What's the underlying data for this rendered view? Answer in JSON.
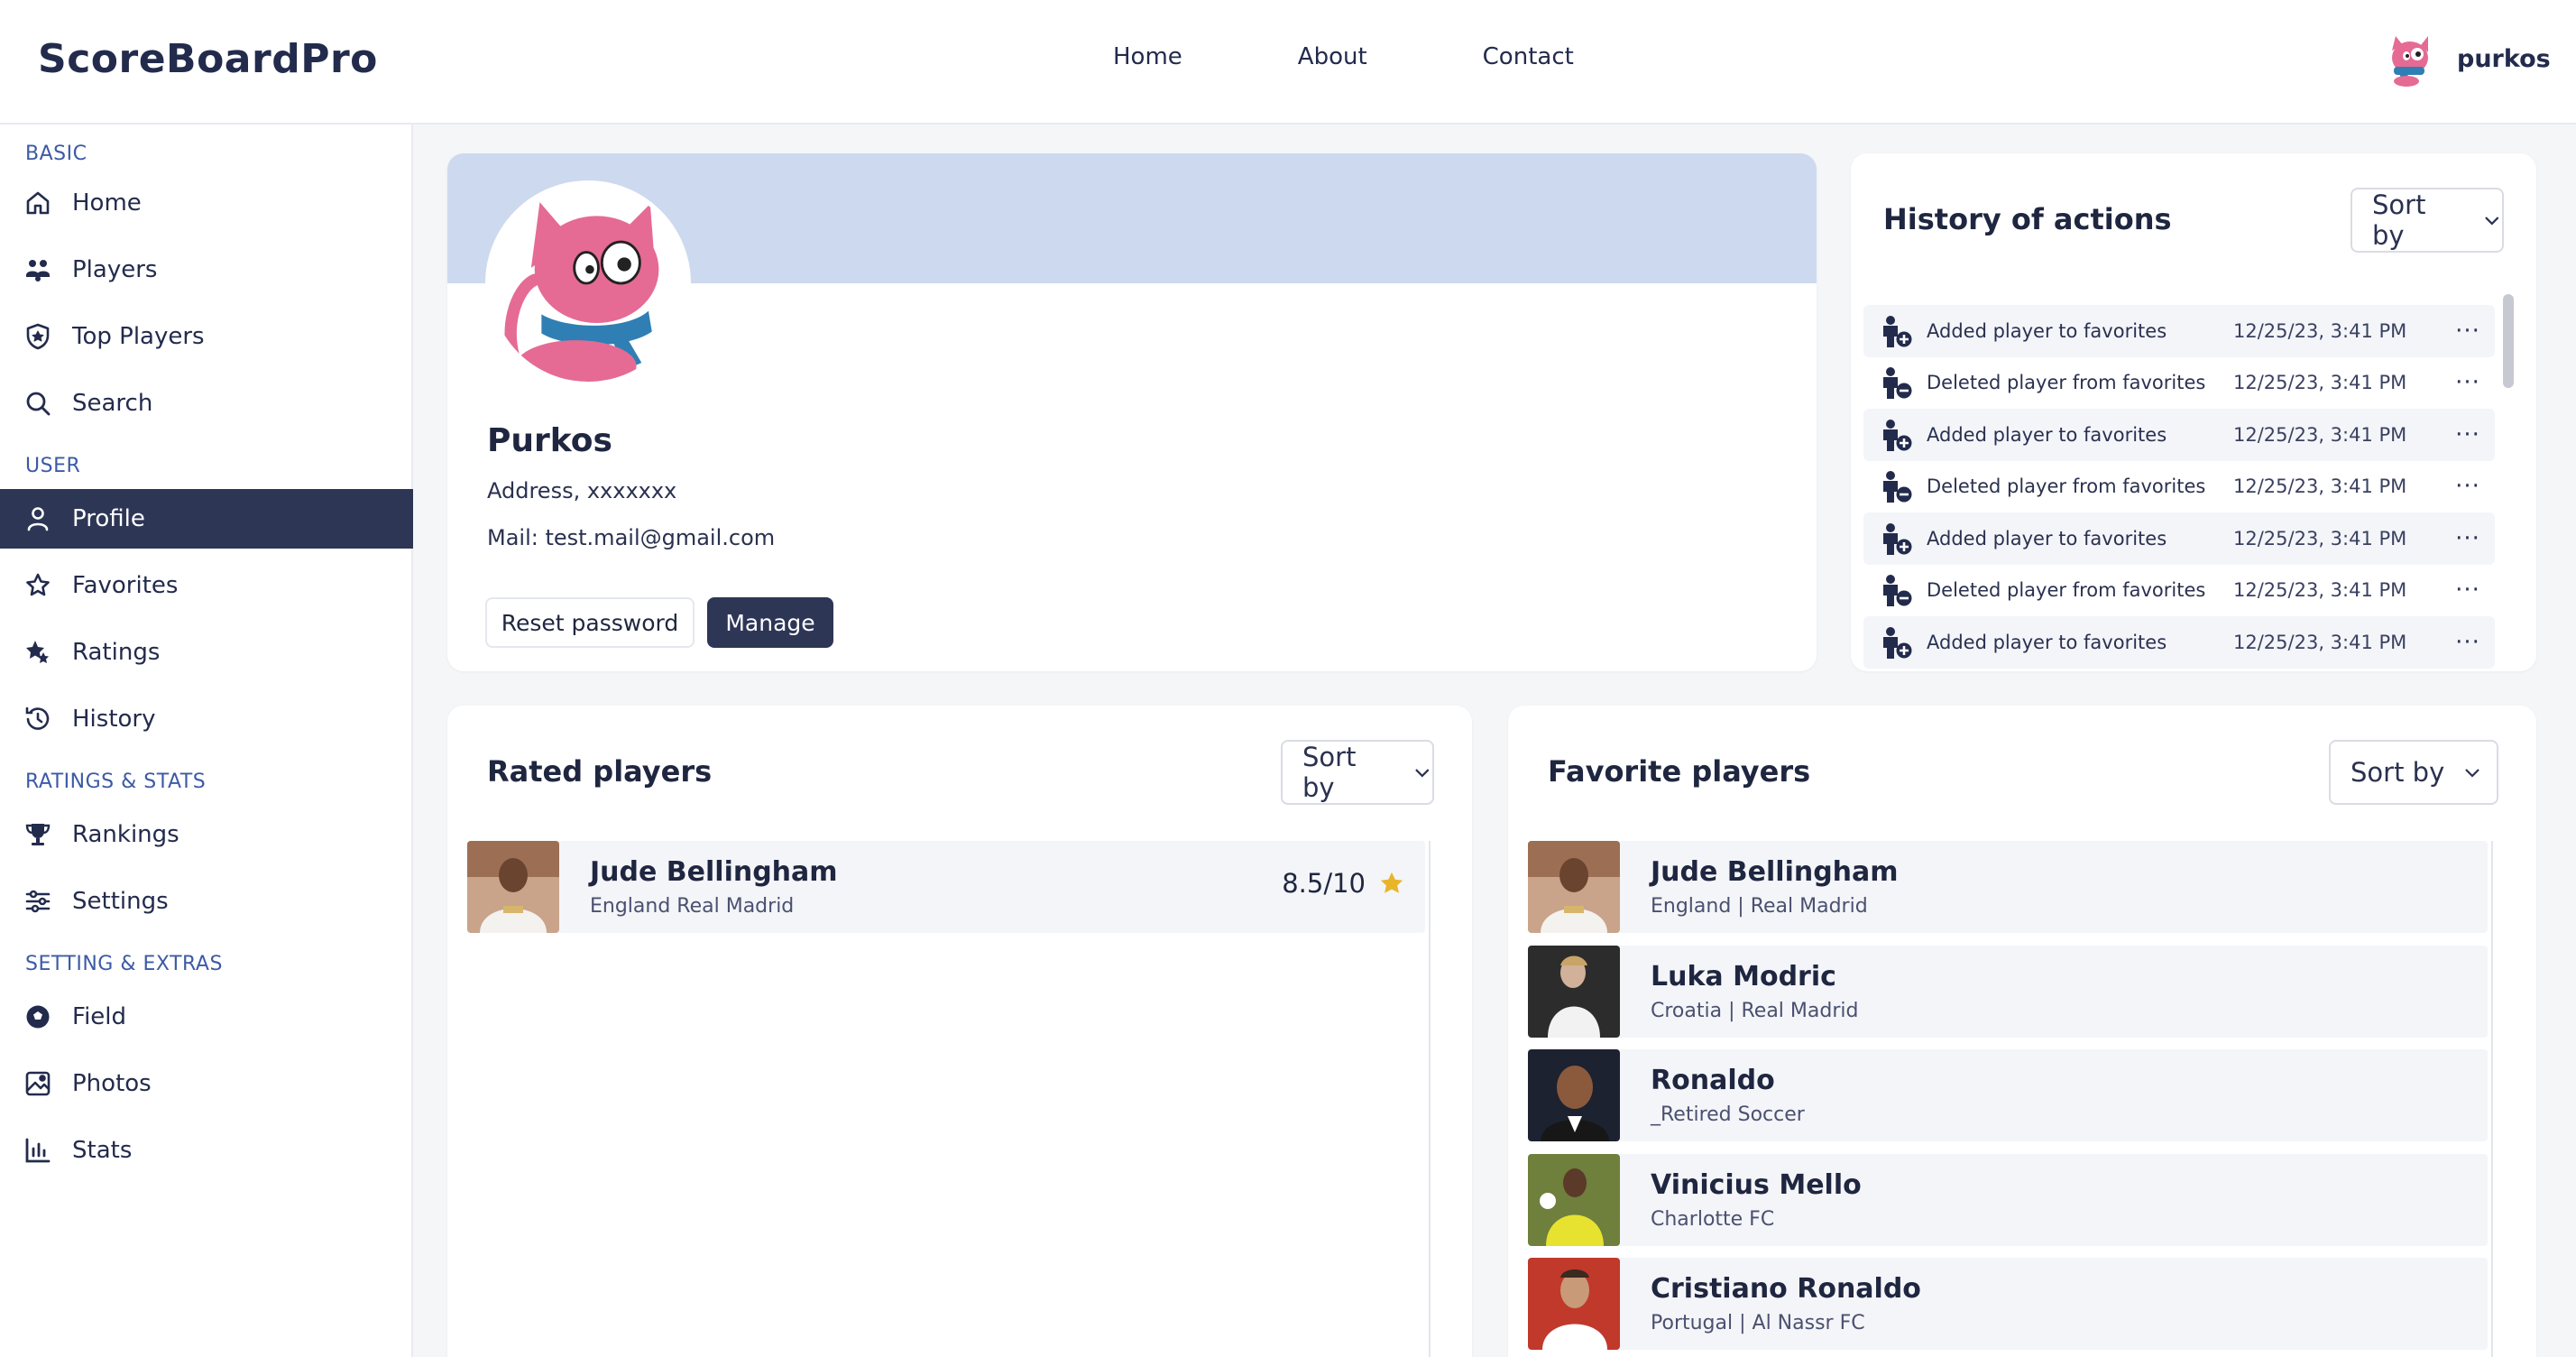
{
  "app": {
    "brand": "ScoreBoardPro"
  },
  "topnav": {
    "home": "Home",
    "about": "About",
    "contact": "Contact"
  },
  "user": {
    "name": "purkos"
  },
  "sidebar": {
    "sections": {
      "basic": "BASIC",
      "user": "USER",
      "ratings_stats": "RATINGS & STATS",
      "settings_extras": "SETTING & EXTRAS"
    },
    "items": {
      "home": "Home",
      "players": "Players",
      "top_players": "Top Players",
      "search": "Search",
      "profile": "Profile",
      "favorites": "Favorites",
      "ratings": "Ratings",
      "history": "History",
      "rankings": "Rankings",
      "settings": "Settings",
      "field": "Field",
      "photos": "Photos",
      "stats": "Stats"
    }
  },
  "profile": {
    "name": "Purkos",
    "address": "Address, xxxxxxx",
    "mail": "Mail: test.mail@gmail.com",
    "reset_password": "Reset password",
    "manage": "Manage"
  },
  "history": {
    "title": "History of actions",
    "sort_label": "Sort by",
    "rows": [
      {
        "action": "Added player to favorites",
        "time": "12/25/23, 3:41 PM",
        "kind": "add"
      },
      {
        "action": "Deleted player from favorites",
        "time": "12/25/23, 3:41 PM",
        "kind": "remove"
      },
      {
        "action": "Added player to favorites",
        "time": "12/25/23, 3:41 PM",
        "kind": "add"
      },
      {
        "action": "Deleted player from favorites",
        "time": "12/25/23, 3:41 PM",
        "kind": "remove"
      },
      {
        "action": "Added player to favorites",
        "time": "12/25/23, 3:41 PM",
        "kind": "add"
      },
      {
        "action": "Deleted player from favorites",
        "time": "12/25/23, 3:41 PM",
        "kind": "remove"
      },
      {
        "action": "Added player to favorites",
        "time": "12/25/23, 3:41 PM",
        "kind": "add"
      }
    ],
    "more_glyph": "···"
  },
  "rated": {
    "title": "Rated players",
    "sort_label": "Sort by",
    "players": [
      {
        "name": "Jude Bellingham",
        "sub": "England Real Madrid",
        "rating": "8.5/10"
      }
    ]
  },
  "favorites": {
    "title": "Favorite players",
    "sort_label": "Sort by",
    "players": [
      {
        "name": "Jude Bellingham",
        "sub": "England | Real Madrid"
      },
      {
        "name": "Luka Modric",
        "sub": "Croatia | Real Madrid"
      },
      {
        "name": "Ronaldo",
        "sub": "_Retired Soccer"
      },
      {
        "name": "Vinicius Mello",
        "sub": " Charlotte FC"
      },
      {
        "name": "Cristiano Ronaldo",
        "sub": "Portugal | Al Nassr FC"
      }
    ]
  },
  "colors": {
    "accent_dark": "#2e3656",
    "banner": "#cdd9ee",
    "section_label": "#3c5aa6",
    "star": "#e8b52a"
  }
}
